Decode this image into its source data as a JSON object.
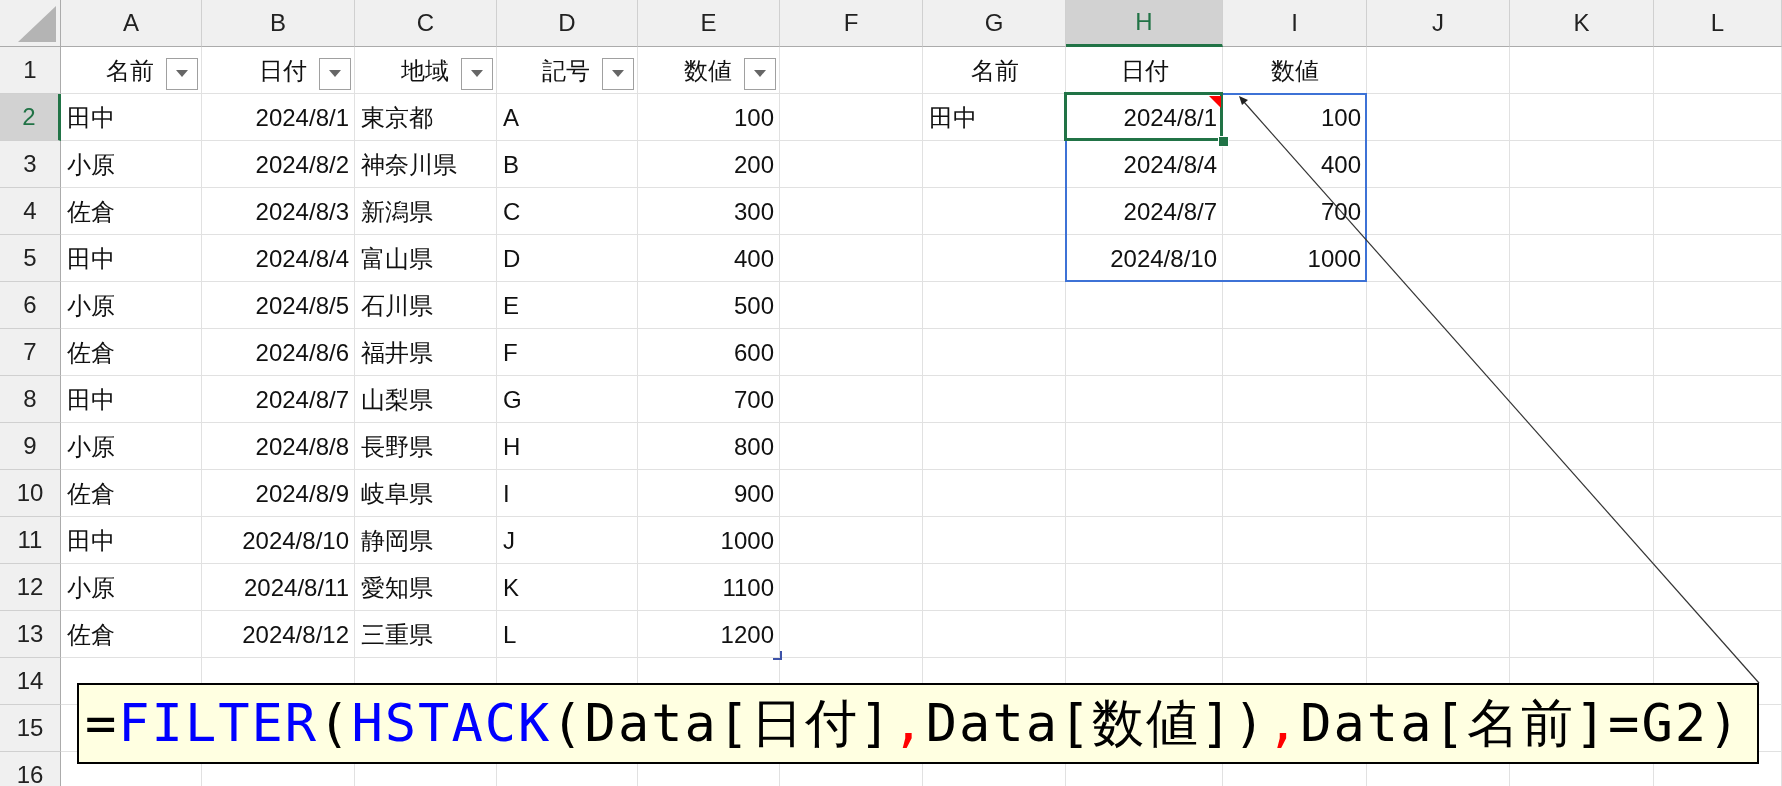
{
  "column_headers": [
    {
      "label": "A",
      "selected": false
    },
    {
      "label": "B",
      "selected": false
    },
    {
      "label": "C",
      "selected": false
    },
    {
      "label": "D",
      "selected": false
    },
    {
      "label": "E",
      "selected": false
    },
    {
      "label": "F",
      "selected": false
    },
    {
      "label": "G",
      "selected": false
    },
    {
      "label": "H",
      "selected": true
    },
    {
      "label": "I",
      "selected": false
    },
    {
      "label": "J",
      "selected": false
    },
    {
      "label": "K",
      "selected": false
    },
    {
      "label": "L",
      "selected": false
    }
  ],
  "row_headers": [
    {
      "label": "1",
      "selected": false
    },
    {
      "label": "2",
      "selected": true
    },
    {
      "label": "3",
      "selected": false
    },
    {
      "label": "4",
      "selected": false
    },
    {
      "label": "5",
      "selected": false
    },
    {
      "label": "6",
      "selected": false
    },
    {
      "label": "7",
      "selected": false
    },
    {
      "label": "8",
      "selected": false
    },
    {
      "label": "9",
      "selected": false
    },
    {
      "label": "10",
      "selected": false
    },
    {
      "label": "11",
      "selected": false
    },
    {
      "label": "12",
      "selected": false
    },
    {
      "label": "13",
      "selected": false
    },
    {
      "label": "14",
      "selected": false
    },
    {
      "label": "15",
      "selected": false
    },
    {
      "label": "16",
      "selected": false
    }
  ],
  "table": {
    "columns": [
      {
        "label": "名前",
        "kind": "text"
      },
      {
        "label": "日付",
        "kind": "number"
      },
      {
        "label": "地域",
        "kind": "text"
      },
      {
        "label": "記号",
        "kind": "text"
      },
      {
        "label": "数値",
        "kind": "number"
      }
    ],
    "rows": [
      [
        "田中",
        "2024/8/1",
        "東京都",
        "A",
        "100"
      ],
      [
        "小原",
        "2024/8/2",
        "神奈川県",
        "B",
        "200"
      ],
      [
        "佐倉",
        "2024/8/3",
        "新潟県",
        "C",
        "300"
      ],
      [
        "田中",
        "2024/8/4",
        "富山県",
        "D",
        "400"
      ],
      [
        "小原",
        "2024/8/5",
        "石川県",
        "E",
        "500"
      ],
      [
        "佐倉",
        "2024/8/6",
        "福井県",
        "F",
        "600"
      ],
      [
        "田中",
        "2024/8/7",
        "山梨県",
        "G",
        "700"
      ],
      [
        "小原",
        "2024/8/8",
        "長野県",
        "H",
        "800"
      ],
      [
        "佐倉",
        "2024/8/9",
        "岐阜県",
        "I",
        "900"
      ],
      [
        "田中",
        "2024/8/10",
        "静岡県",
        "J",
        "1000"
      ],
      [
        "小原",
        "2024/8/11",
        "愛知県",
        "K",
        "1100"
      ],
      [
        "佐倉",
        "2024/8/12",
        "三重県",
        "L",
        "1200"
      ]
    ]
  },
  "result": {
    "headers": [
      "名前",
      "日付",
      "数値"
    ],
    "criterion": "田中",
    "rows": [
      [
        "2024/8/1",
        "100"
      ],
      [
        "2024/8/4",
        "400"
      ],
      [
        "2024/8/7",
        "700"
      ],
      [
        "2024/8/10",
        "1000"
      ]
    ]
  },
  "formula_callout": {
    "segments": [
      {
        "text": "=",
        "color": "#000000"
      },
      {
        "text": "FILTER",
        "color": "#0000ff"
      },
      {
        "text": "(",
        "color": "#000000"
      },
      {
        "text": "HSTACK",
        "color": "#0000ff"
      },
      {
        "text": "(Data[日付]",
        "color": "#000000"
      },
      {
        "text": ",",
        "color": "#ff0000"
      },
      {
        "text": "Data[数値])",
        "color": "#000000"
      },
      {
        "text": ",",
        "color": "#ff0000"
      },
      {
        "text": "Data[名前]=G2)",
        "color": "#000000"
      }
    ]
  }
}
